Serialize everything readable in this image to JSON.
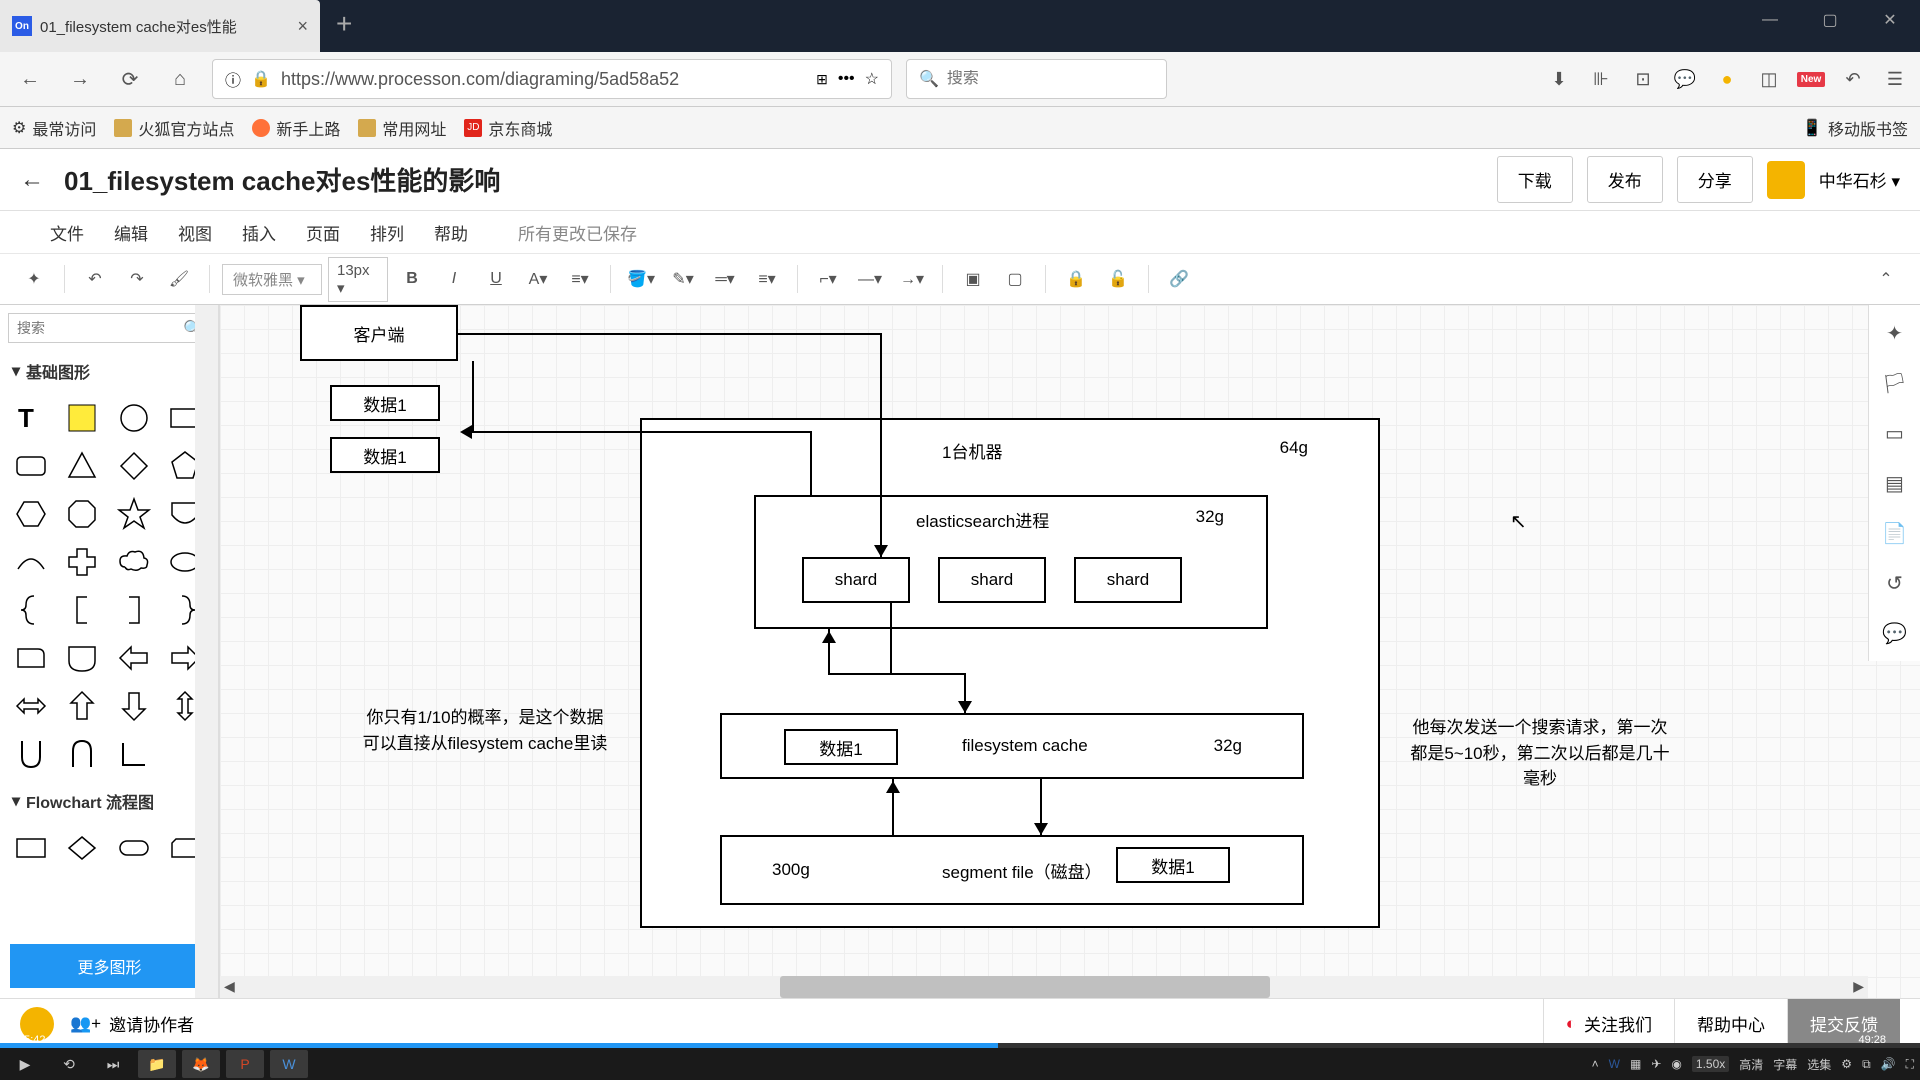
{
  "browser": {
    "tab_title": "01_filesystem cache对es性能",
    "tab_icon": "On",
    "url": "https://www.processon.com/diagraming/5ad58a52",
    "search_placeholder": "搜索",
    "new_label": "New",
    "bookmarks": {
      "most_visited": "最常访问",
      "firefox_official": "火狐官方站点",
      "getting_started": "新手上路",
      "common_sites": "常用网址",
      "jd_mall": "京东商城",
      "mobile_bookmarks": "移动版书签"
    }
  },
  "app": {
    "doc_title": "01_filesystem cache对es性能的影响",
    "buttons": {
      "download": "下载",
      "publish": "发布",
      "share": "分享"
    },
    "username": "中华石杉",
    "menu": {
      "file": "文件",
      "edit": "编辑",
      "view": "视图",
      "insert": "插入",
      "page": "页面",
      "arrange": "排列",
      "help": "帮助"
    },
    "save_status": "所有更改已保存",
    "font_name": "微软雅黑",
    "font_size": "13px"
  },
  "sidebar": {
    "search_placeholder": "搜索",
    "basic_shapes": "基础图形",
    "flowchart": "Flowchart 流程图",
    "more_shapes": "更多图形"
  },
  "diagram": {
    "client": "客户端",
    "data1_a": "数据1",
    "data1_b": "数据1",
    "machine": "1台机器",
    "machine_mem": "64g",
    "es_process": "elasticsearch进程",
    "es_mem": "32g",
    "shard": "shard",
    "fscache": "filesystem cache",
    "fscache_mem": "32g",
    "fscache_data": "数据1",
    "segment": "segment file（磁盘）",
    "segment_size": "300g",
    "segment_data": "数据1",
    "note_left": "你只有1/10的概率，是这个数据可以直接从filesystem cache里读",
    "note_right": "他每次发送一个搜索请求，第一次都是5~10秒，第二次以后都是几十毫秒"
  },
  "footer": {
    "invite": "邀请协作者",
    "follow": "关注我们",
    "help": "帮助中心",
    "feedback": "提交反馈"
  },
  "video": {
    "current": "25:42",
    "total": "49:28",
    "speed": "1.50x",
    "hd": "高清",
    "subtitle": "字幕",
    "playlist": "选集"
  }
}
